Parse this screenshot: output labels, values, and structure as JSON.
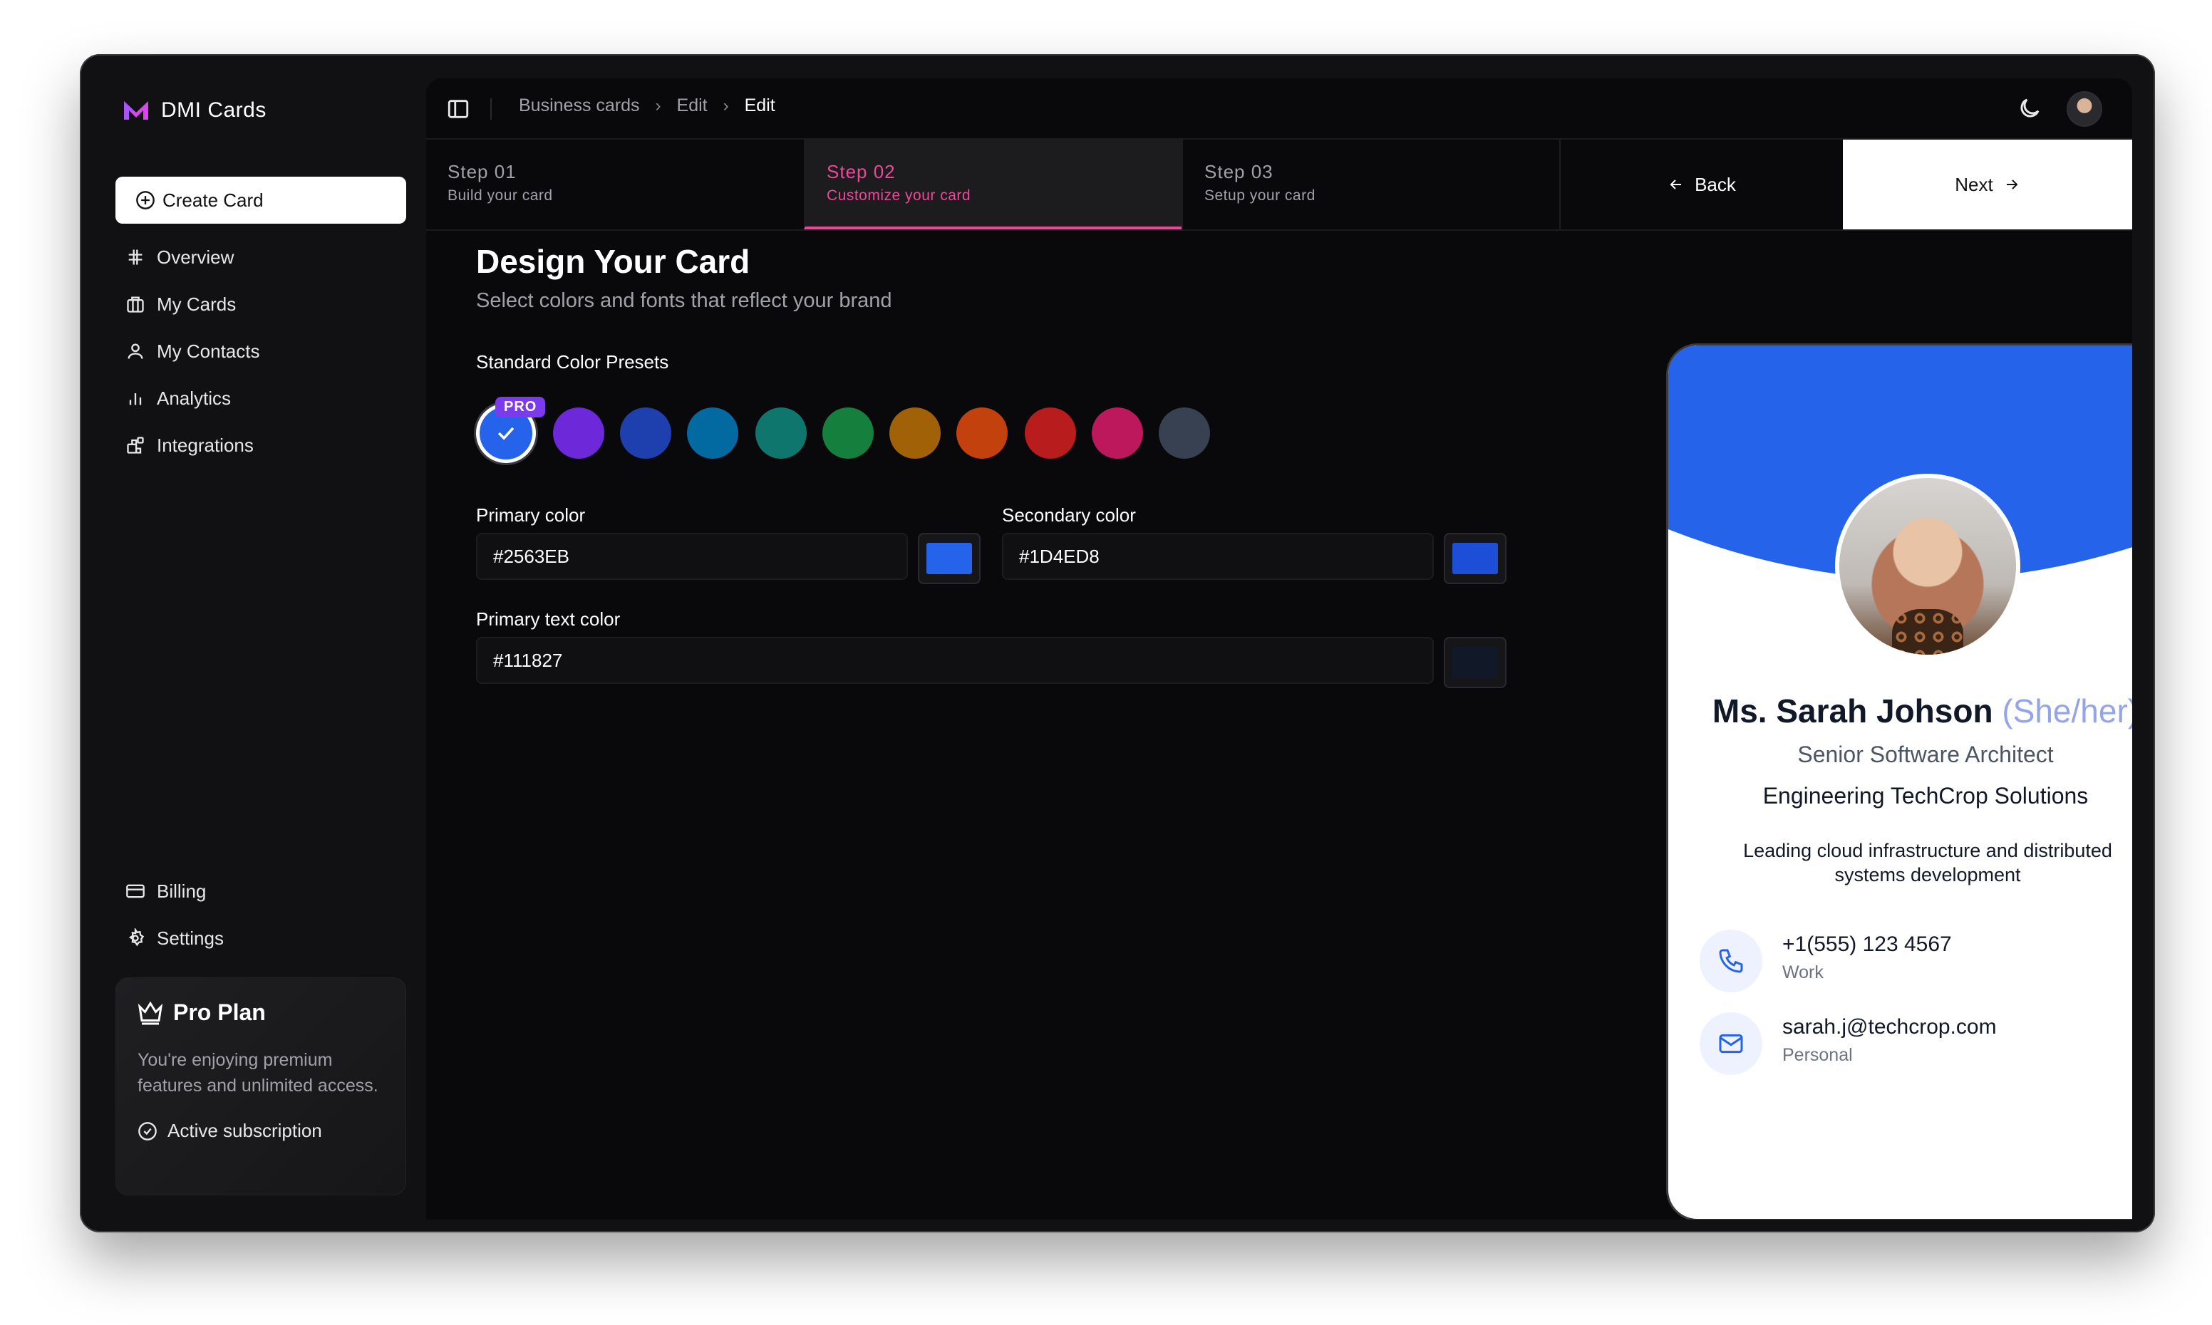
{
  "app": {
    "name": "DMI Cards",
    "brand_color": "#d946ef"
  },
  "sidebar": {
    "create_label": "Create Card",
    "items": [
      {
        "label": "Overview",
        "icon": "hash-icon"
      },
      {
        "label": "My Cards",
        "icon": "cards-icon"
      },
      {
        "label": "My Contacts",
        "icon": "user-icon"
      },
      {
        "label": "Analytics",
        "icon": "bar-chart-icon"
      },
      {
        "label": "Integrations",
        "icon": "blocks-icon"
      }
    ],
    "bottom_items": [
      {
        "label": "Billing",
        "icon": "credit-card-icon"
      },
      {
        "label": "Settings",
        "icon": "gear-icon"
      }
    ],
    "plan": {
      "title": "Pro Plan",
      "description": "You're enjoying premium features and unlimited access.",
      "status": "Active subscription"
    }
  },
  "breadcrumb": {
    "items": [
      "Business cards",
      "Edit"
    ],
    "current": "Edit"
  },
  "steps": [
    {
      "number": "Step 01",
      "label": "Build your card"
    },
    {
      "number": "Step 02",
      "label": "Customize your card",
      "active": true
    },
    {
      "number": "Step 03",
      "label": "Setup your card"
    }
  ],
  "nav_buttons": {
    "back": "Back",
    "next": "Next"
  },
  "editor": {
    "title": "Design Your Card",
    "subtitle": "Select colors and fonts that reflect your brand",
    "presets_label": "Standard Color Presets",
    "pro_badge": "PRO",
    "presets": [
      "#2563eb",
      "#6d28d9",
      "#1e40af",
      "#0369a1",
      "#0f766e",
      "#15803d",
      "#a16207",
      "#c2410c",
      "#b91c1c",
      "#be185d",
      "#374151"
    ],
    "selected_preset": 0,
    "primary_label": "Primary color",
    "primary_value": "#2563EB",
    "secondary_label": "Secondary color",
    "secondary_value": "#1D4ED8",
    "text_label": "Primary text color",
    "text_value": "#111827"
  },
  "card": {
    "name": "Ms. Sarah Johson",
    "pronouns": "(She/her)",
    "job_title": "Senior Software Architect",
    "company": "Engineering TechCrop Solutions",
    "bio": "Leading cloud infrastructure and distributed systems development",
    "phone": "+1(555) 123 4567",
    "phone_type": "Work",
    "email": "sarah.j@techcrop.com",
    "email_type": "Personal",
    "hero_color": "#2563eb"
  }
}
